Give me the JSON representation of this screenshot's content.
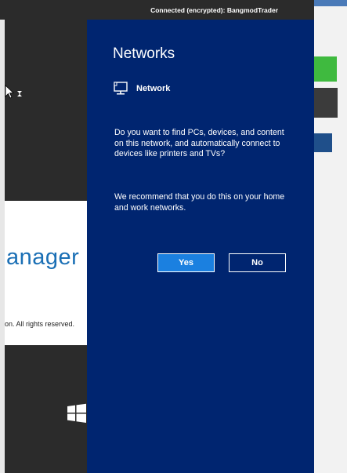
{
  "connection_banner": {
    "text": "Connected (encrypted): BangmodTrader"
  },
  "background": {
    "brand_fragment": "anager",
    "copyright_fragment": "on. All rights reserved."
  },
  "networks_panel": {
    "title": "Networks",
    "network_name": "Network",
    "network_icon": "network-monitor-icon",
    "question": "Do you want to find PCs, devices, and content on this network, and automatically connect to devices like printers and TVs?",
    "recommendation": "We recommend that you do this on your home and work networks.",
    "yes_label": "Yes",
    "no_label": "No"
  },
  "colors": {
    "panel_background": "#002570",
    "yes_button": "#1b80e0",
    "brand_blue": "#1a6fb5"
  }
}
